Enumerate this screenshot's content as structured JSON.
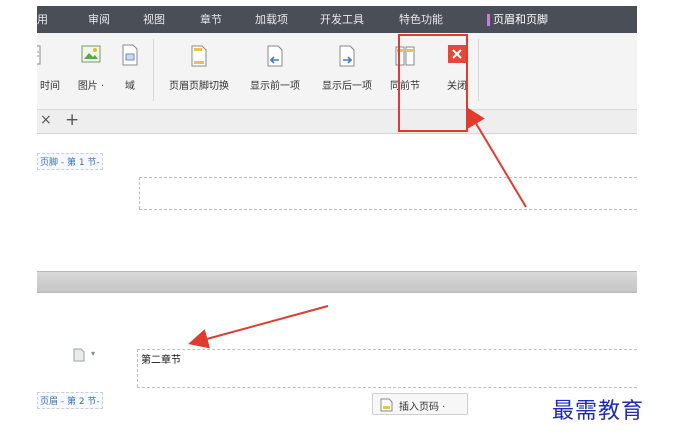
{
  "menu": {
    "items": [
      "用",
      "审阅",
      "视图",
      "章节",
      "加载项",
      "开发工具",
      "特色功能"
    ],
    "active": "页眉和页脚"
  },
  "ribbon": {
    "time": "时间",
    "picture": "图片 ·",
    "field": "域",
    "switch": "页眉页脚切换",
    "show_prev": "显示前一项",
    "show_next": "显示后一项",
    "same_as_prev": "同前节",
    "close": "关闭"
  },
  "tabs": {
    "close": "×",
    "add": "+"
  },
  "document": {
    "footer_label": "页脚 - 第 1 节-",
    "header_label": "页眉 - 第 2 节-",
    "chapter_text": "第二章节",
    "doc_icon_glyph": "▾",
    "insert_page_number": "插入页码 ·"
  },
  "watermark": "最需教育",
  "colors": {
    "menubar": "#4a4f57",
    "highlight": "#e23b2e",
    "watermark": "#1f2bb3",
    "label": "#3b6fb6"
  }
}
